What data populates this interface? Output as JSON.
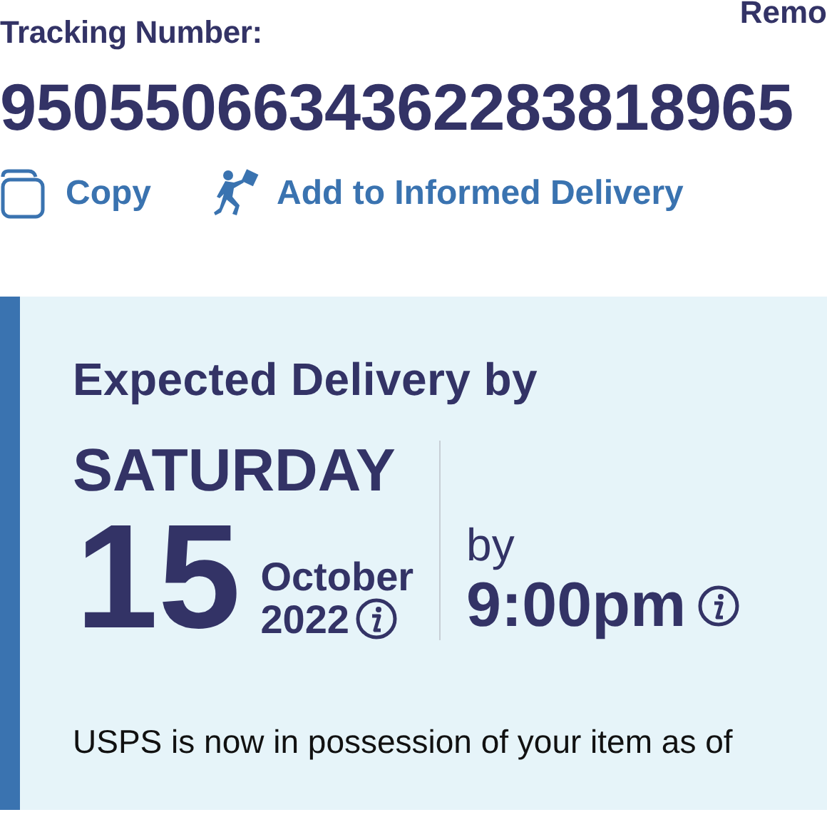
{
  "header": {
    "label": "Tracking Number:",
    "remove_link": "Remo",
    "tracking_number": "9505506634362283818965"
  },
  "actions": [
    {
      "kind": "copy",
      "label": "Copy"
    },
    {
      "kind": "informed",
      "label": "Add to Informed Delivery"
    }
  ],
  "delivery": {
    "heading": "Expected Delivery by",
    "weekday": "SATURDAY",
    "day": "15",
    "month": "October",
    "year": "2022",
    "by": "by",
    "time": "9:00pm",
    "status_text": "USPS is now in possession of your item as of"
  }
}
